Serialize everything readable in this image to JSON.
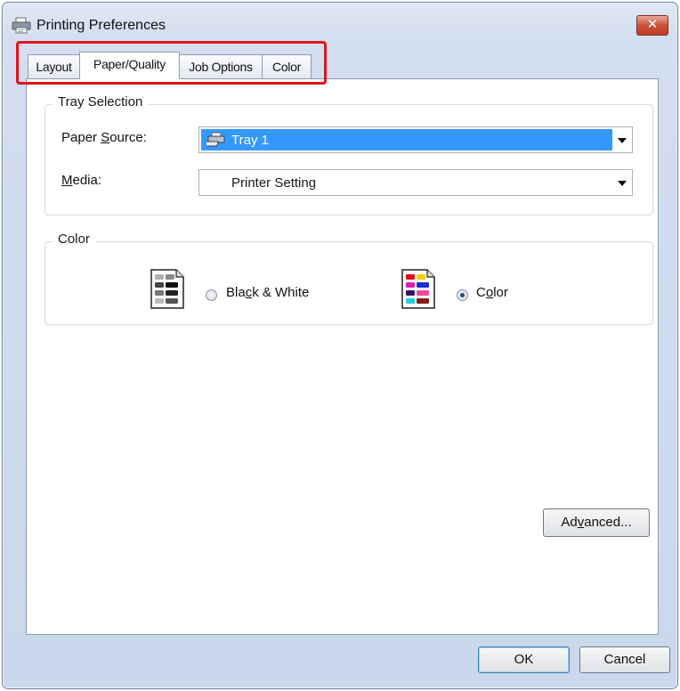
{
  "window": {
    "title": "Printing Preferences",
    "close_glyph": "✕"
  },
  "tabs": [
    {
      "label": "Layout",
      "active": false
    },
    {
      "label": "Paper/Quality",
      "active": true
    },
    {
      "label": "Job Options",
      "active": false
    },
    {
      "label": "Color",
      "active": false
    }
  ],
  "tray_selection": {
    "legend": "Tray Selection",
    "paper_source_label_pre": "Paper ",
    "paper_source_label_key": "S",
    "paper_source_label_post": "ource:",
    "paper_source_value": "Tray 1",
    "media_label_key": "M",
    "media_label_post": "edia:",
    "media_value": "Printer Setting"
  },
  "color_group": {
    "legend": "Color",
    "bw_label_pre": "Bla",
    "bw_label_key": "c",
    "bw_label_post": "k & White",
    "bw_checked": false,
    "color_label_pre": "C",
    "color_label_key": "o",
    "color_label_post": "lor",
    "color_checked": true
  },
  "buttons": {
    "advanced_pre": "Ad",
    "advanced_key": "v",
    "advanced_post": "anced...",
    "ok": "OK",
    "cancel": "Cancel"
  },
  "icons": {
    "app": "printer-icon",
    "tray": "printer-tray-icon",
    "bw_doc": "grayscale-document-icon",
    "color_doc": "color-document-icon"
  },
  "colors": {
    "selection": "#3399ff",
    "highlight_annotation": "#e0141b",
    "close_button": "#c9523c"
  }
}
